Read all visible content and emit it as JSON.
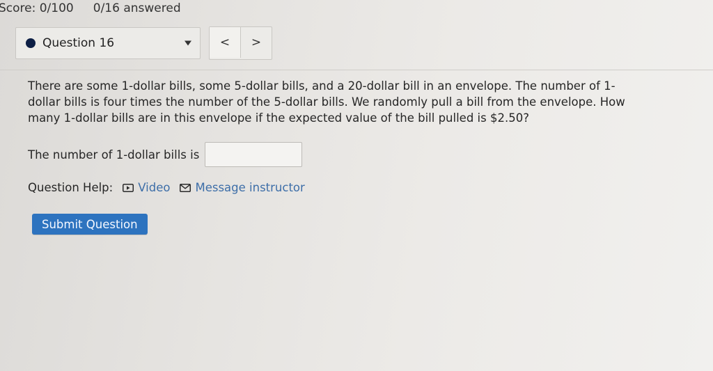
{
  "header": {
    "score": "Score: 0/100",
    "answered": "0/16 answered"
  },
  "nav": {
    "question_label": "Question 16",
    "prev_symbol": "<",
    "next_symbol": ">"
  },
  "question": {
    "text": "There are some 1-dollar bills, some 5-dollar bills, and a 20-dollar bill in an envelope. The number of 1-dollar bills is four times the number of the 5-dollar bills. We randomly pull a bill from the envelope. How many 1-dollar bills are in this envelope if the expected value of the bill pulled is $2.50?",
    "answer_prompt": "The number of 1-dollar bills is",
    "answer_value": ""
  },
  "help": {
    "label": "Question Help:",
    "video_label": "Video",
    "message_label": "Message instructor"
  },
  "actions": {
    "submit_label": "Submit Question"
  },
  "colors": {
    "link": "#3d6ea8",
    "submit_bg": "#2d73bf",
    "status_dot": "#0d1f45"
  }
}
